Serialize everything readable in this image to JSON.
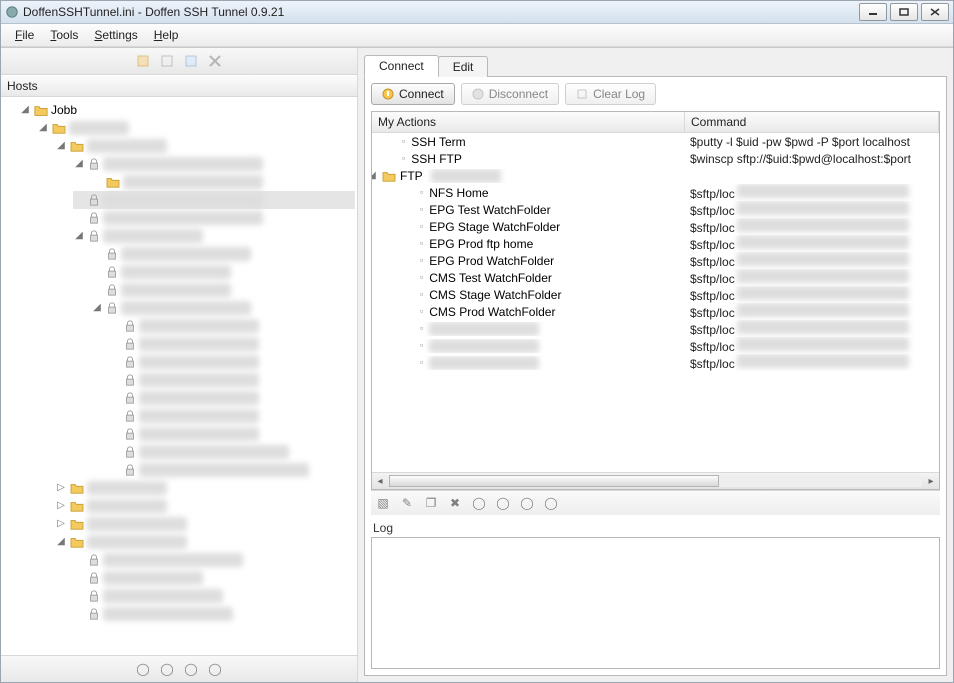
{
  "window": {
    "title": "DoffenSSHTunnel.ini - Doffen SSH Tunnel 0.9.21"
  },
  "menubar": [
    "File",
    "Tools",
    "Settings",
    "Help"
  ],
  "left": {
    "header": "Hosts",
    "root_label": "Jobb"
  },
  "tabs": {
    "connect": "Connect",
    "edit": "Edit"
  },
  "buttons": {
    "connect": "Connect",
    "disconnect": "Disconnect",
    "clearlog": "Clear Log"
  },
  "actions_table": {
    "headers": {
      "action": "My Actions",
      "command": "Command"
    },
    "rows": [
      {
        "indent": 1,
        "type": "bullet",
        "label": "SSH Term",
        "cmd": "$putty -l $uid -pw $pwd -P $port localhost",
        "blur_cmd": false
      },
      {
        "indent": 1,
        "type": "bullet",
        "label": "SSH FTP",
        "cmd": "$winscp sftp://$uid:$pwd@localhost:$port",
        "blur_cmd": false
      },
      {
        "indent": 0,
        "type": "folder",
        "label": "FTP",
        "label_extra_blur": true,
        "cmd": "",
        "blur_cmd": false
      },
      {
        "indent": 2,
        "type": "bullet",
        "label": "NFS Home",
        "cmd": "$sftp/loc",
        "blur_cmd": true
      },
      {
        "indent": 2,
        "type": "bullet",
        "label": "EPG Test WatchFolder",
        "cmd": "$sftp/loc",
        "blur_cmd": true
      },
      {
        "indent": 2,
        "type": "bullet",
        "label": "EPG Stage WatchFolder",
        "cmd": "$sftp/loc",
        "blur_cmd": true
      },
      {
        "indent": 2,
        "type": "bullet",
        "label": "EPG Prod ftp home",
        "cmd": "$sftp/loc",
        "blur_cmd": true
      },
      {
        "indent": 2,
        "type": "bullet",
        "label": "EPG Prod WatchFolder",
        "cmd": "$sftp/loc",
        "blur_cmd": true
      },
      {
        "indent": 2,
        "type": "bullet",
        "label": "CMS Test WatchFolder",
        "cmd": "$sftp/loc",
        "blur_cmd": true
      },
      {
        "indent": 2,
        "type": "bullet",
        "label": "CMS Stage WatchFolder",
        "cmd": "$sftp/loc",
        "blur_cmd": true
      },
      {
        "indent": 2,
        "type": "bullet",
        "label": "CMS Prod WatchFolder",
        "cmd": "$sftp/loc",
        "blur_cmd": true
      },
      {
        "indent": 2,
        "type": "bullet",
        "label": "",
        "label_blur": true,
        "cmd": "$sftp/loc",
        "blur_cmd": true
      },
      {
        "indent": 2,
        "type": "bullet",
        "label": "",
        "label_blur": true,
        "cmd": "$sftp/loc",
        "blur_cmd": true
      },
      {
        "indent": 2,
        "type": "bullet",
        "label": "",
        "label_blur": true,
        "cmd": "$sftp/loc",
        "blur_cmd": true
      }
    ]
  },
  "log": {
    "label": "Log"
  },
  "blur_text": "██████████████████"
}
